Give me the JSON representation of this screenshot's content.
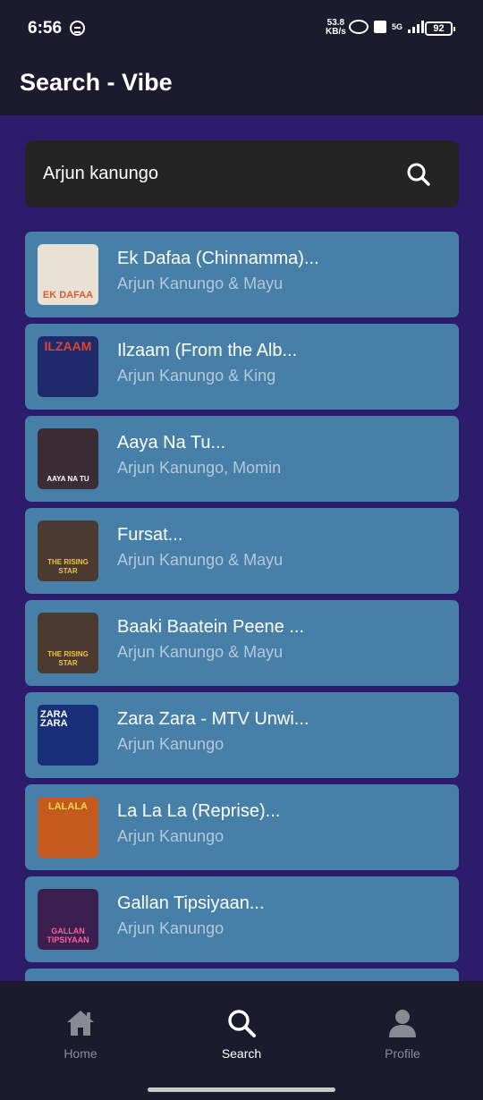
{
  "status_bar": {
    "time": "6:56",
    "speed_value": "53.8",
    "speed_unit": "KB/s",
    "network": "5G",
    "battery": "92"
  },
  "app_bar": {
    "title": "Search - Vibe"
  },
  "search": {
    "value": "Arjun kanungo",
    "icon": "search-icon"
  },
  "results": [
    {
      "title": "Ek Dafaa (Chinnamma)...",
      "artist": "Arjun Kanungo & Mayu",
      "art_text": "EK DAFAA",
      "art_bg": "#e9e1d6",
      "art_color": "#e15a2a"
    },
    {
      "title": "Ilzaam (From the Alb...",
      "artist": "Arjun Kanungo & King",
      "art_text": "ILZAAM",
      "art_bg": "#1f2a6b",
      "art_color": "#e2452f"
    },
    {
      "title": "Aaya Na Tu...",
      "artist": "Arjun Kanungo, Momin",
      "art_text": "AAYA NA TU",
      "art_bg": "#3b2c35",
      "art_color": "#ffffff"
    },
    {
      "title": "Fursat...",
      "artist": "Arjun Kanungo & Mayu",
      "art_text": "THE RISING STAR",
      "art_bg": "#4a3a30",
      "art_color": "#f0c23c"
    },
    {
      "title": "Baaki Baatein Peene ...",
      "artist": "Arjun Kanungo & Mayu",
      "art_text": "THE RISING STAR",
      "art_bg": "#4a3a30",
      "art_color": "#f0c23c"
    },
    {
      "title": "Zara Zara - MTV Unwi...",
      "artist": "Arjun Kanungo",
      "art_text": "ZARA ZARA",
      "art_bg": "#1a2f7a",
      "art_color": "#ffffff"
    },
    {
      "title": "La La La (Reprise)...",
      "artist": "Arjun Kanungo",
      "art_text": "LALALA",
      "art_bg": "#c55a1e",
      "art_color": "#ffd54a"
    },
    {
      "title": "Gallan Tipsiyaan...",
      "artist": "Arjun Kanungo",
      "art_text": "GALLAN TIPSIYAAN",
      "art_bg": "#3a1f4f",
      "art_color": "#ff5ca8"
    }
  ],
  "nav": {
    "home": {
      "label": "Home",
      "icon": "home-icon"
    },
    "search": {
      "label": "Search",
      "icon": "search-icon"
    },
    "profile": {
      "label": "Profile",
      "icon": "profile-icon"
    }
  },
  "colors": {
    "background": "#2c1c6b",
    "app_bar": "#1c1b2d",
    "search_box": "#242424",
    "list_item": "#467fa7",
    "nav_active": "#ffffff",
    "nav_inactive": "#8a8a94"
  }
}
